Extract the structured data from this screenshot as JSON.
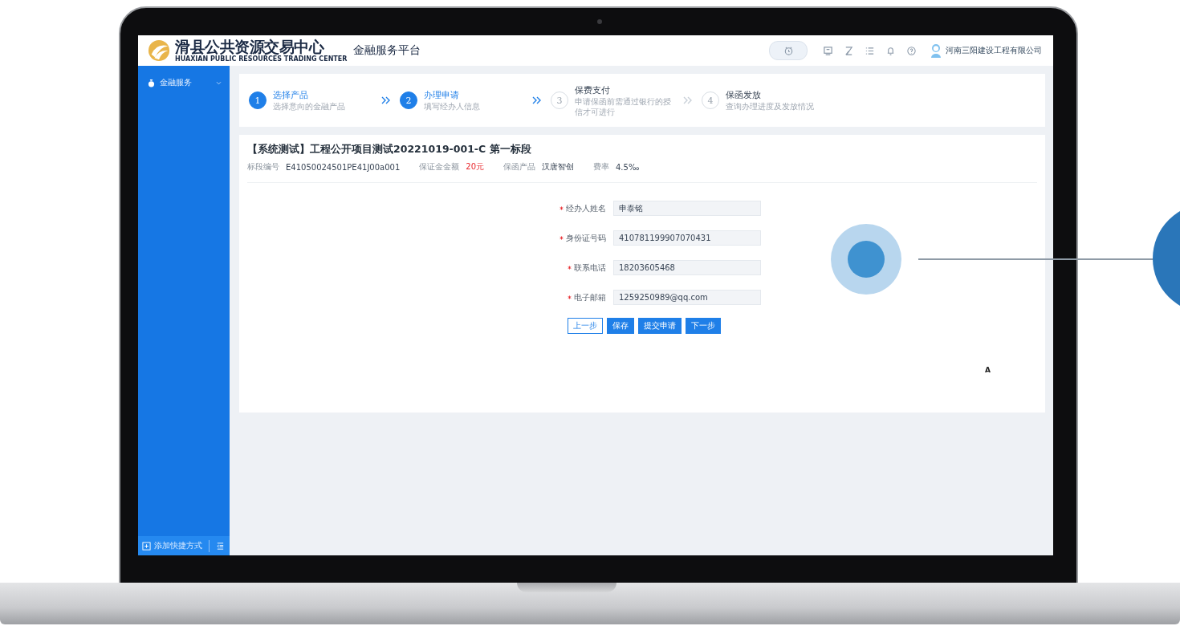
{
  "header": {
    "logo_title": "滑县公共资源交易中心",
    "logo_subtitle": "HUAXIAN PUBLIC RESOURCES TRADING CENTER",
    "platform": "金融服务平台",
    "user": "河南三阳建设工程有限公司"
  },
  "sidebar": {
    "items": [
      {
        "label": "金融服务",
        "expanded": false
      }
    ],
    "footer": {
      "shortcut": "添加快捷方式"
    }
  },
  "steps": [
    {
      "number": "1",
      "title": "选择产品",
      "desc": "选择意向的金融产品",
      "active": true
    },
    {
      "number": "2",
      "title": "办理申请",
      "desc": "填写经办人信息",
      "active": true
    },
    {
      "number": "3",
      "title": "保费支付",
      "desc": "申请保函前需通过银行的授信才可进行",
      "active": false
    },
    {
      "number": "4",
      "title": "保函发放",
      "desc": "查询办理进度及发放情况",
      "active": false
    }
  ],
  "project": {
    "title": "【系统测试】工程公开项目测试20221019-001-C 第一标段",
    "meta": [
      {
        "label": "标段编号",
        "value": "E41050024501PE41J00a001",
        "highlight": false
      },
      {
        "label": "保证金金额",
        "value": "20元",
        "highlight": true
      },
      {
        "label": "保函产品",
        "value": "汉唐智创",
        "highlight": false
      },
      {
        "label": "费率",
        "value": "4.5‰",
        "highlight": false
      }
    ]
  },
  "form": {
    "fields": [
      {
        "label": "经办人姓名",
        "value": "申泰铭",
        "required": true
      },
      {
        "label": "身份证号码",
        "value": "410781199907070431",
        "required": true
      },
      {
        "label": "联系电话",
        "value": "18203605468",
        "required": true
      },
      {
        "label": "电子邮箱",
        "value": "1259250989@qq.com",
        "required": true
      }
    ],
    "buttons": [
      {
        "label": "上一步",
        "kind": "outline"
      },
      {
        "label": "保存",
        "kind": "primary"
      },
      {
        "label": "提交申请",
        "kind": "primary"
      },
      {
        "label": "下一步",
        "kind": "primary"
      }
    ]
  },
  "stray_text": "A"
}
